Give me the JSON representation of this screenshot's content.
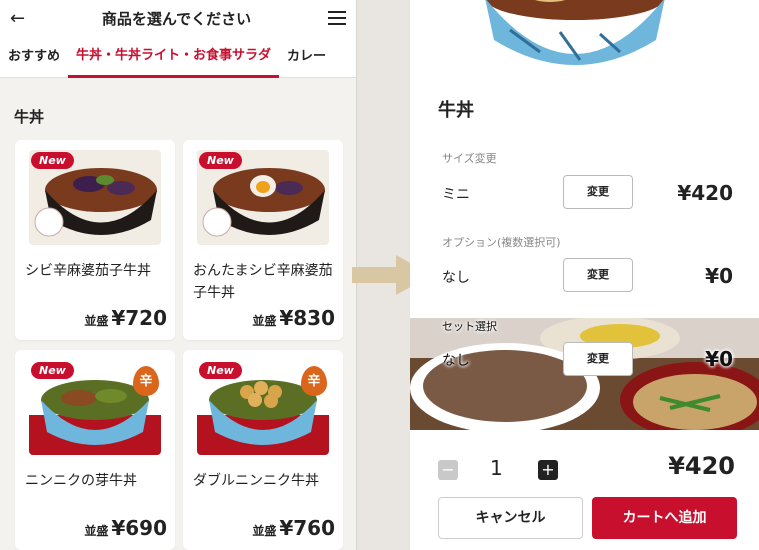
{
  "left": {
    "header": {
      "back_icon": "arrow-left-icon",
      "title": "商品を選んでください",
      "menu_icon": "hamburger-icon"
    },
    "tabs": [
      {
        "label": "おすすめ",
        "active": false
      },
      {
        "label": "牛丼・牛丼ライト・お食事サラダ",
        "active": true
      },
      {
        "label": "カレー",
        "active": false
      }
    ],
    "section_title": "牛丼",
    "products": [
      {
        "name": "シビ辛麻婆茄子牛丼",
        "size": "並盛",
        "price": "¥720",
        "badge": "New",
        "spicy": false
      },
      {
        "name": "おんたまシビ辛麻婆茄子牛丼",
        "size": "並盛",
        "price": "¥830",
        "badge": "New",
        "spicy": false
      },
      {
        "name": "ニンニクの芽牛丼",
        "size": "並盛",
        "price": "¥690",
        "badge": "New",
        "spicy": true,
        "spicy_label": "辛"
      },
      {
        "name": "ダブルニンニク牛丼",
        "size": "並盛",
        "price": "¥760",
        "badge": "New",
        "spicy": true,
        "spicy_label": "辛"
      }
    ]
  },
  "right": {
    "title": "牛丼",
    "options": [
      {
        "label": "サイズ変更",
        "value": "ミニ",
        "button": "変更",
        "price": "¥420"
      },
      {
        "label": "オプション(複数選択可)",
        "value": "なし",
        "button": "変更",
        "price": "¥0"
      },
      {
        "label": "セット選択",
        "value": "なし",
        "button": "変更",
        "price": "¥0"
      }
    ],
    "quantity": {
      "minus": "−",
      "value": "1",
      "plus": "+"
    },
    "total": "¥420",
    "cancel_label": "キャンセル",
    "add_label": "カートへ追加"
  },
  "colors": {
    "accent": "#c8102e",
    "background": "#f4f2ee",
    "arrow": "#d9c7a3"
  }
}
